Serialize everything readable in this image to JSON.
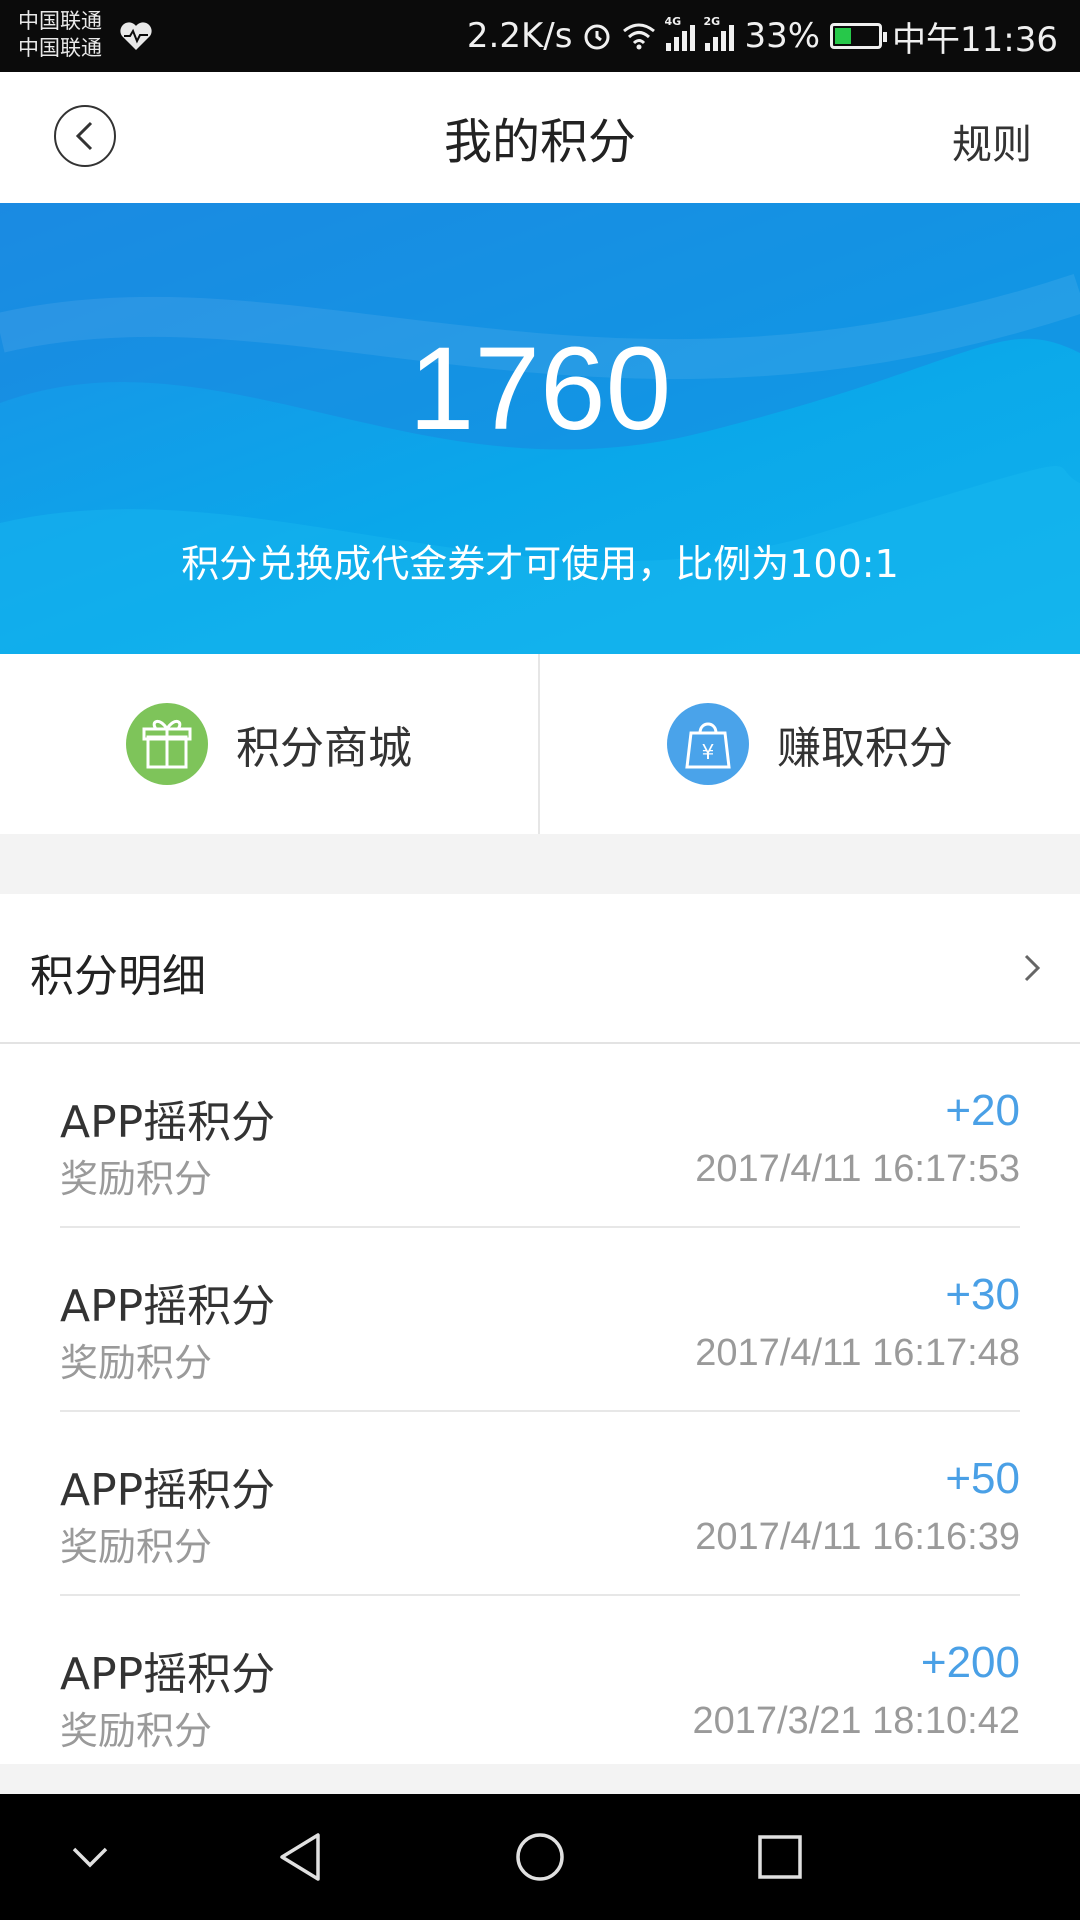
{
  "status_bar": {
    "carrier_1": "中国联通",
    "carrier_2": "中国联通",
    "net_speed": "2.2K/s",
    "sim1_tag": "4G",
    "sim2_tag": "2G",
    "battery_percent": "33%",
    "time": "中午11:36",
    "battery_color": "#27c84a"
  },
  "header": {
    "title": "我的积分",
    "rules_label": "规则"
  },
  "banner": {
    "points": "1760",
    "note": "积分兑换成代金券才可使用，比例为100:1",
    "gradient_colors": [
      "#1d8fe6",
      "#11b3ec"
    ]
  },
  "actions": [
    {
      "label": "积分商城",
      "icon": "gift-icon",
      "color": "#7ec45a"
    },
    {
      "label": "赚取积分",
      "icon": "shopping-bag-yen-icon",
      "color": "#4aa3ea"
    }
  ],
  "details": {
    "title": "积分明细",
    "records": [
      {
        "name": "APP摇积分",
        "type": "奖励积分",
        "amount": "+20",
        "time": "2017/4/11 16:17:53"
      },
      {
        "name": "APP摇积分",
        "type": "奖励积分",
        "amount": "+30",
        "time": "2017/4/11 16:17:48"
      },
      {
        "name": "APP摇积分",
        "type": "奖励积分",
        "amount": "+50",
        "time": "2017/4/11 16:16:39"
      },
      {
        "name": "APP摇积分",
        "type": "奖励积分",
        "amount": "+200",
        "time": "2017/3/21 18:10:42"
      }
    ]
  },
  "colors": {
    "amount": "#4aa0e6",
    "secondary_text": "#9a9a9a"
  }
}
